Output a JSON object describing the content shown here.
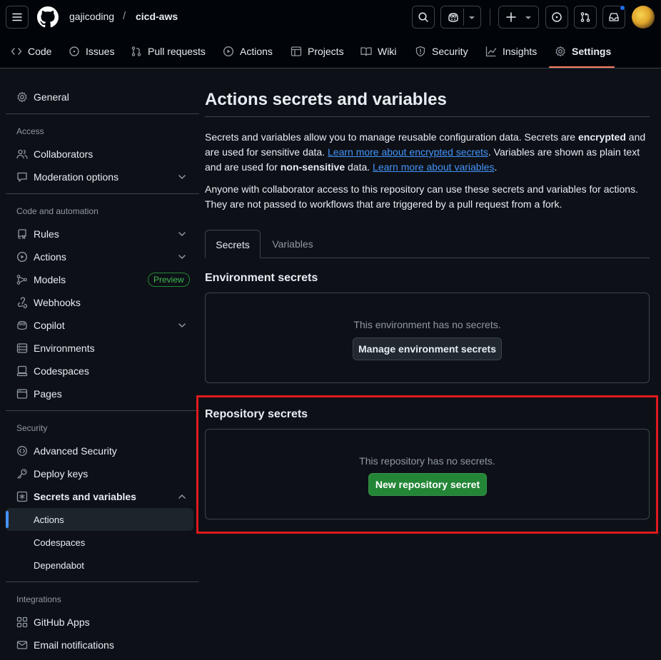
{
  "header": {
    "owner": "gajicoding",
    "separator": "/",
    "repo": "cicd-aws",
    "icons": [
      "hamburger-icon",
      "github-logo-icon",
      "search-icon",
      "copilot-icon",
      "plus-icon",
      "issue-icon",
      "pull-request-icon",
      "inbox-icon"
    ],
    "notification_color": "#1f6feb"
  },
  "reponav": {
    "tabs": [
      {
        "label": "Code",
        "icon": "code-icon"
      },
      {
        "label": "Issues",
        "icon": "issue-icon"
      },
      {
        "label": "Pull requests",
        "icon": "pull-request-icon"
      },
      {
        "label": "Actions",
        "icon": "play-icon"
      },
      {
        "label": "Projects",
        "icon": "table-icon"
      },
      {
        "label": "Wiki",
        "icon": "book-icon"
      },
      {
        "label": "Security",
        "icon": "shield-icon"
      },
      {
        "label": "Insights",
        "icon": "graph-icon"
      },
      {
        "label": "Settings",
        "icon": "gear-icon",
        "active": true
      }
    ],
    "active_underline_color": "#f78166"
  },
  "sidebar": {
    "general": "General",
    "access_heading": "Access",
    "collaborators": "Collaborators",
    "moderation": "Moderation options",
    "code_heading": "Code and automation",
    "rules": "Rules",
    "actions": "Actions",
    "models": "Models",
    "preview_badge": "Preview",
    "webhooks": "Webhooks",
    "copilot": "Copilot",
    "environments": "Environments",
    "codespaces": "Codespaces",
    "pages": "Pages",
    "security_heading": "Security",
    "advanced_security": "Advanced Security",
    "deploy_keys": "Deploy keys",
    "secrets_and_variables": "Secrets and variables",
    "sub_actions": "Actions",
    "sub_codespaces": "Codespaces",
    "sub_dependabot": "Dependabot",
    "integrations_heading": "Integrations",
    "github_apps": "GitHub Apps",
    "email_notifications": "Email notifications"
  },
  "main": {
    "title": "Actions secrets and variables",
    "para1": {
      "t1": "Secrets and variables allow you to manage reusable configuration data. Secrets are ",
      "b1": "encrypted",
      "t2": " and are used for sensitive data. ",
      "link1": "Learn more about encrypted secrets",
      "t3": ". Variables are shown as plain text and are used for ",
      "b2": "non-sensitive",
      "t4": " data. ",
      "link2": "Learn more about variables",
      "t5": "."
    },
    "para2": "Anyone with collaborator access to this repository can use these secrets and variables for actions. They are not passed to workflows that are triggered by a pull request from a fork.",
    "tabs": {
      "secrets": "Secrets",
      "variables": "Variables"
    },
    "env_heading": "Environment secrets",
    "env_empty": "This environment has no secrets.",
    "env_button": "Manage environment secrets",
    "repo_heading": "Repository secrets",
    "repo_empty": "This repository has no secrets.",
    "repo_button": "New repository secret",
    "highlight_color": "#e0191b",
    "primary_button_color": "#238636"
  }
}
